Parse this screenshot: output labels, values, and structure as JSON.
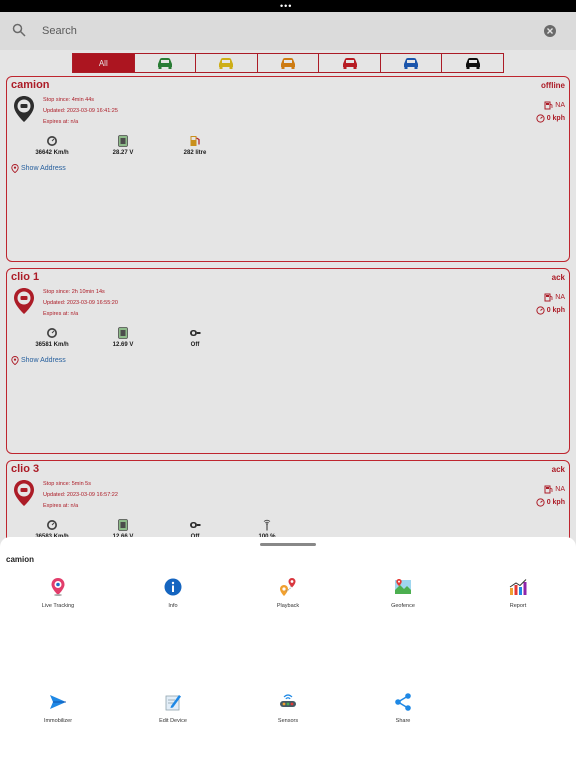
{
  "search": {
    "placeholder": "Search"
  },
  "filters": {
    "all_label": "All",
    "car_colors": [
      "#2e8b3c",
      "#e5c21a",
      "#e58a15",
      "#cc2129",
      "#1f5fbf",
      "#111111"
    ]
  },
  "vehicles": [
    {
      "name": "camion",
      "status": "offline",
      "pin_color": "#333333",
      "stop_since": "Stop since: 4min 44s",
      "updated": "Updated: 2023-03-09 16:41:25",
      "expires": "Expires at: n/a",
      "fuel_text": "NA",
      "speed_text": "0 kph",
      "stats": [
        {
          "icon": "odometer-icon",
          "value": "36642 Km/h"
        },
        {
          "icon": "battery-icon",
          "value": "28.27 V"
        },
        {
          "icon": "fuel-pump-icon",
          "value": "282 litre"
        }
      ],
      "address_label": "Show Address"
    },
    {
      "name": "clio 1",
      "status": "ack",
      "pin_color": "#c0202c",
      "stop_since": "Stop since: 2h 10min 14s",
      "updated": "Updated: 2023-03-09 16:55:20",
      "expires": "Expires at: n/a",
      "fuel_text": "NA",
      "speed_text": "0 kph",
      "stats": [
        {
          "icon": "odometer-icon",
          "value": "36581 Km/h"
        },
        {
          "icon": "battery-icon",
          "value": "12.69 V"
        },
        {
          "icon": "ignition-icon",
          "value": "Off"
        }
      ],
      "address_label": "Show Address"
    },
    {
      "name": "clio 3",
      "status": "ack",
      "pin_color": "#c0202c",
      "stop_since": "Stop since: 5min 5s",
      "updated": "Updated: 2023-03-09 16:57:22",
      "expires": "Expires at: n/a",
      "fuel_text": "NA",
      "speed_text": "0 kph",
      "stats": [
        {
          "icon": "odometer-icon",
          "value": "36583 Km/h"
        },
        {
          "icon": "battery-icon",
          "value": "12.66 V"
        },
        {
          "icon": "ignition-icon",
          "value": "Off"
        },
        {
          "icon": "signal-icon",
          "value": "100 %"
        }
      ]
    }
  ],
  "sheet": {
    "title": "camion",
    "actions": [
      {
        "label": "Live Tracking",
        "icon": "live-tracking-icon"
      },
      {
        "label": "Info",
        "icon": "info-icon"
      },
      {
        "label": "Playback",
        "icon": "playback-icon"
      },
      {
        "label": "Geofence",
        "icon": "geofence-icon"
      },
      {
        "label": "Report",
        "icon": "report-icon"
      },
      {
        "label": "Immobilizer",
        "icon": "immobilizer-icon"
      },
      {
        "label": "Edit Device",
        "icon": "edit-device-icon"
      },
      {
        "label": "Sensors",
        "icon": "sensors-icon"
      },
      {
        "label": "Share",
        "icon": "share-icon"
      }
    ]
  }
}
